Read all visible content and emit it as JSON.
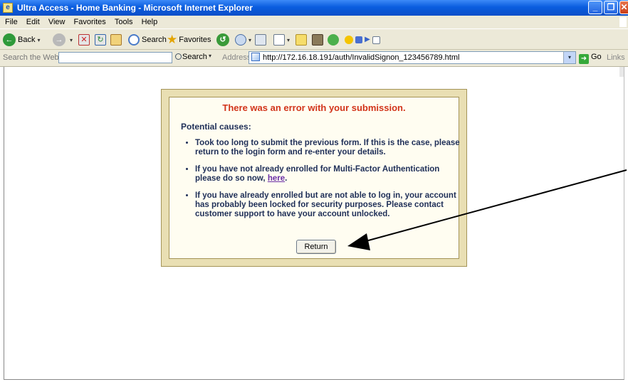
{
  "window": {
    "title": "Ultra Access - Home Banking - Microsoft Internet Explorer",
    "icon": "ie-page-icon"
  },
  "menu": [
    "File",
    "Edit",
    "View",
    "Favorites",
    "Tools",
    "Help"
  ],
  "toolbar": {
    "back_label": "Back",
    "search_label": "Search",
    "favorites_label": "Favorites"
  },
  "addressbar": {
    "search_the_web_label": "Search the Web",
    "search_button_label": "Search",
    "address_label": "Address",
    "url": "http://172.16.18.191/auth/InvalidSignon_123456789.html",
    "go_label": "Go",
    "links_label": "Links"
  },
  "error": {
    "title": "There was an error with your submission.",
    "causes_heading": "Potential causes:",
    "cause1": "Took too long to submit the previous form. If this is the case, please return to the login form and re-enter your details.",
    "cause2_before": "If you have not already enrolled for Multi-Factor Authentication please do so now, ",
    "cause2_link": "here",
    "cause2_after": ".",
    "cause3": "If you have already enrolled but are not able to log in, your account has probably been locked for security purposes. Please contact customer support to have your account unlocked.",
    "return_label": "Return"
  },
  "colors": {
    "error_title": "#d2341a",
    "text": "#1f2f58",
    "link": "#6b2fa6",
    "box_border": "#e9dfb3",
    "titlebar": "#0a5ddf"
  }
}
